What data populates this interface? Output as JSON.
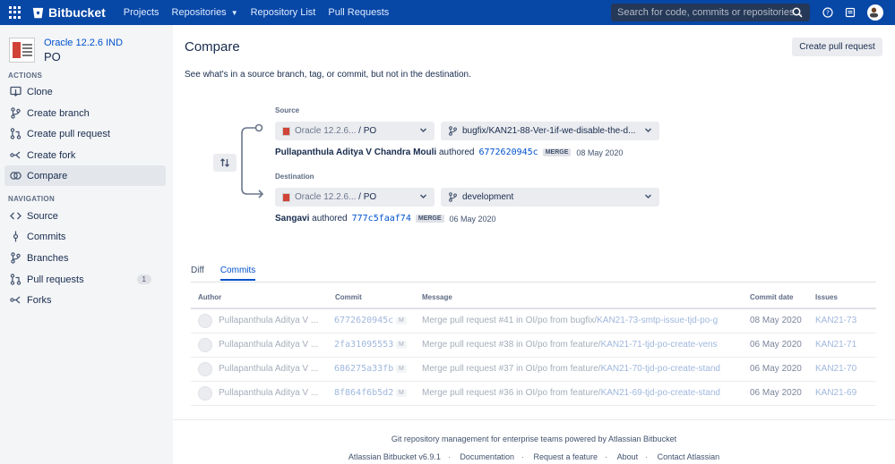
{
  "topnav": {
    "brand": "Bitbucket",
    "items": [
      {
        "label": "Projects"
      },
      {
        "label": "Repositories",
        "has_caret": true
      },
      {
        "label": "Repository List"
      },
      {
        "label": "Pull Requests"
      }
    ],
    "search_placeholder": "Search for code, commits or repositories..."
  },
  "sidebar": {
    "project": "Oracle 12.2.6 IND",
    "repo": "PO",
    "actions_heading": "ACTIONS",
    "actions": [
      {
        "label": "Clone",
        "icon": "clone-icon"
      },
      {
        "label": "Create branch",
        "icon": "branch-icon"
      },
      {
        "label": "Create pull request",
        "icon": "pull-request-icon"
      },
      {
        "label": "Create fork",
        "icon": "fork-icon"
      },
      {
        "label": "Compare",
        "icon": "compare-icon",
        "active": true
      }
    ],
    "navigation_heading": "NAVIGATION",
    "navigation": [
      {
        "label": "Source",
        "icon": "source-icon"
      },
      {
        "label": "Commits",
        "icon": "commits-icon"
      },
      {
        "label": "Branches",
        "icon": "branches-icon"
      },
      {
        "label": "Pull requests",
        "icon": "pull-requests-icon",
        "count": "1"
      },
      {
        "label": "Forks",
        "icon": "forks-icon"
      }
    ]
  },
  "main": {
    "title": "Compare",
    "create_pr_button": "Create pull request",
    "description": "See what's in a source branch, tag, or commit, but not in the destination.",
    "source": {
      "label": "Source",
      "repo_prefix": "Oracle 12.2.6...",
      "repo_name": " / PO",
      "branch": "bugfix/KAN21-88-Ver-1if-we-disable-the-d...",
      "author": "Pullapanthula Aditya V Chandra Mouli",
      "authored": "authored",
      "hash": "6772620945c",
      "tag": "MERGE",
      "date": "08 May 2020"
    },
    "destination": {
      "label": "Destination",
      "repo_prefix": "Oracle 12.2.6...",
      "repo_name": " / PO",
      "branch": "development",
      "author": "Sangavi",
      "authored": "authored",
      "hash": "777c5faaf74",
      "tag": "MERGE",
      "date": "06 May 2020"
    },
    "tabs": [
      {
        "label": "Diff"
      },
      {
        "label": "Commits",
        "active": true
      }
    ],
    "table": {
      "headers": {
        "author": "Author",
        "commit": "Commit",
        "message": "Message",
        "date": "Commit date",
        "issues": "Issues"
      },
      "rows": [
        {
          "author": "Pullapanthula Aditya V ...",
          "hash": "6772620945c",
          "tag": "M",
          "msg_prefix": "Merge pull request #41 in OI/po from bugfix/",
          "msg_link": "KAN21-73-smtp-issue-tjd-po-g",
          "date": "08 May 2020",
          "issue": "KAN21-73"
        },
        {
          "author": "Pullapanthula Aditya V ...",
          "hash": "2fa31095553",
          "tag": "M",
          "msg_prefix": "Merge pull request #38 in OI/po from feature/",
          "msg_link": "KAN21-71-tjd-po-create-vens",
          "date": "06 May 2020",
          "issue": "KAN21-71"
        },
        {
          "author": "Pullapanthula Aditya V ...",
          "hash": "686275a33fb",
          "tag": "M",
          "msg_prefix": "Merge pull request #37 in OI/po from feature/",
          "msg_link": "KAN21-70-tjd-po-create-stand",
          "date": "06 May 2020",
          "issue": "KAN21-70"
        },
        {
          "author": "Pullapanthula Aditya V ...",
          "hash": "8f864f6b5d2",
          "tag": "M",
          "msg_prefix": "Merge pull request #36 in OI/po from feature/",
          "msg_link": "KAN21-69-tjd-po-create-stand",
          "date": "06 May 2020",
          "issue": "KAN21-69"
        }
      ]
    }
  },
  "footer": {
    "tagline": "Git repository management for enterprise teams powered by Atlassian Bitbucket",
    "links": [
      "Atlassian Bitbucket v6.9.1",
      "Documentation",
      "Request a feature",
      "About",
      "Contact Atlassian"
    ],
    "separator": "·"
  },
  "colors": {
    "nav_bg": "#0747a6",
    "link": "#0052cc",
    "sidebar_bg": "#f4f5f7"
  }
}
